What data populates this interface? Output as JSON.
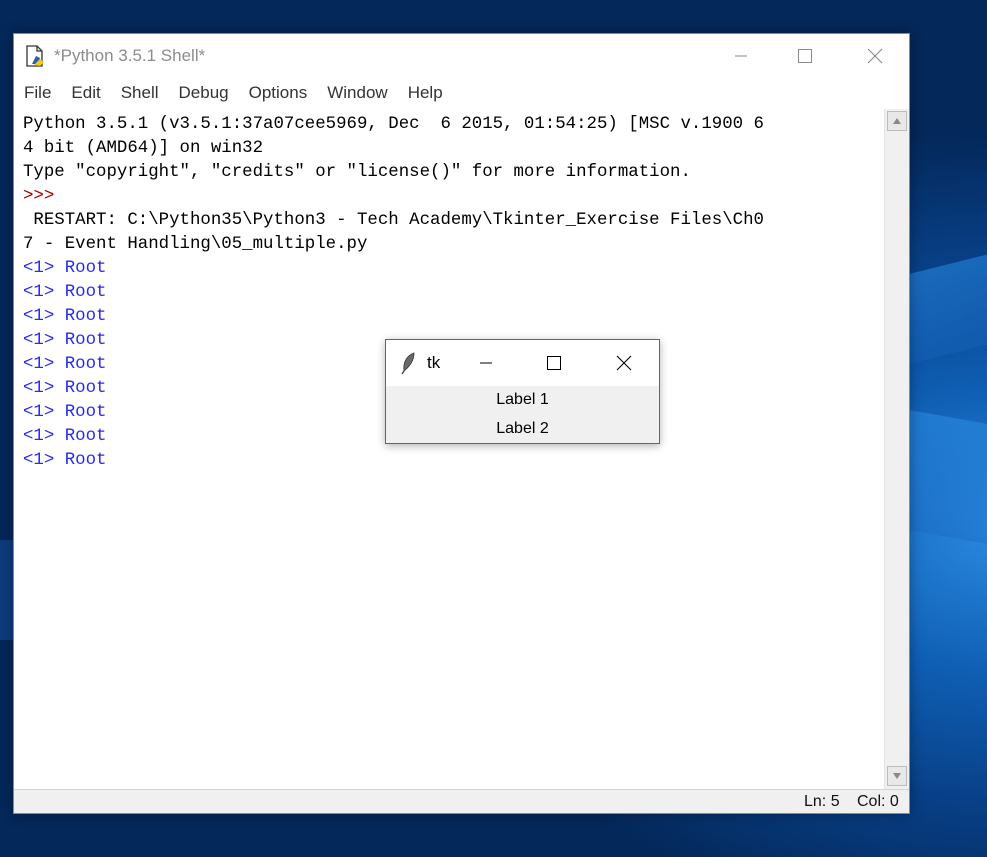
{
  "idle": {
    "title": "*Python 3.5.1 Shell*",
    "menu": [
      "File",
      "Edit",
      "Shell",
      "Debug",
      "Options",
      "Window",
      "Help"
    ],
    "lines": [
      {
        "text": "Python 3.5.1 (v3.5.1:37a07cee5969, Dec  6 2015, 01:54:25) [MSC v.1900 6",
        "kind": "normal"
      },
      {
        "text": "4 bit (AMD64)] on win32",
        "kind": "normal"
      },
      {
        "text": "Type \"copyright\", \"credits\" or \"license()\" for more information.",
        "kind": "normal"
      },
      {
        "text": ">>>",
        "kind": "prompt"
      },
      {
        "text": " RESTART: C:\\Python35\\Python3 - Tech Academy\\Tkinter_Exercise Files\\Ch0",
        "kind": "normal"
      },
      {
        "text": "7 - Event Handling\\05_multiple.py",
        "kind": "normal"
      },
      {
        "text": "<1> Root",
        "kind": "output"
      },
      {
        "text": "<1> Root",
        "kind": "output"
      },
      {
        "text": "<1> Root",
        "kind": "output"
      },
      {
        "text": "<1> Root",
        "kind": "output"
      },
      {
        "text": "<1> Root",
        "kind": "output"
      },
      {
        "text": "<1> Root",
        "kind": "output"
      },
      {
        "text": "<1> Root",
        "kind": "output"
      },
      {
        "text": "<1> Root",
        "kind": "output"
      },
      {
        "text": "<1> Root",
        "kind": "output"
      }
    ],
    "status": {
      "line": "Ln: 5",
      "col": "Col: 0"
    }
  },
  "tk": {
    "title": "tk",
    "labels": [
      "Label 1",
      "Label 2"
    ]
  },
  "colors": {
    "prompt": "#a00000",
    "output": "#2a2af0",
    "tk_border": "#1a78c8"
  }
}
